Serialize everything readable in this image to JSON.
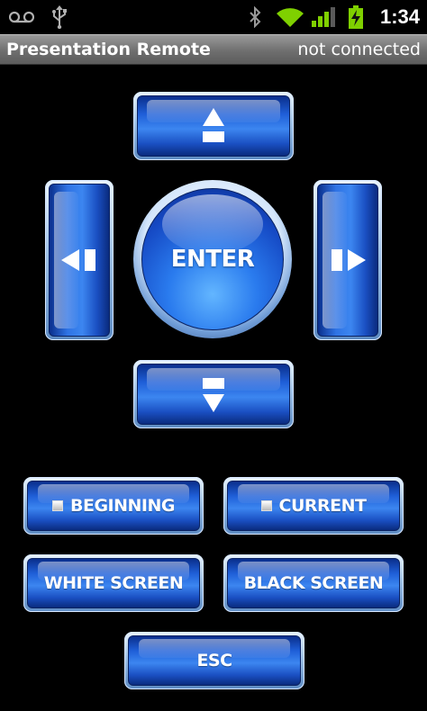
{
  "status_bar": {
    "icons": [
      "voicemail-icon",
      "usb-icon",
      "bluetooth-icon",
      "wifi-icon",
      "signal-icon",
      "battery-charging-icon"
    ],
    "time": "1:34",
    "colors": {
      "wifi": "#7fd000",
      "signal": "#7fd000",
      "battery": "#7fd000"
    }
  },
  "title_bar": {
    "title": "Presentation Remote",
    "connection_status": "not connected"
  },
  "dpad": {
    "enter_label": "ENTER",
    "up_icon": "arrow-up-icon",
    "down_icon": "arrow-down-icon",
    "left_icon": "arrow-left-icon",
    "right_icon": "arrow-right-icon"
  },
  "buttons": {
    "beginning": "BEGINNING",
    "current": "CURRENT",
    "white_screen": "WHITE SCREEN",
    "black_screen": "BLACK SCREEN",
    "esc": "ESC"
  },
  "colors": {
    "button_blue": "#1f5fd8",
    "title_bar_gray": "#6f6f6f"
  }
}
